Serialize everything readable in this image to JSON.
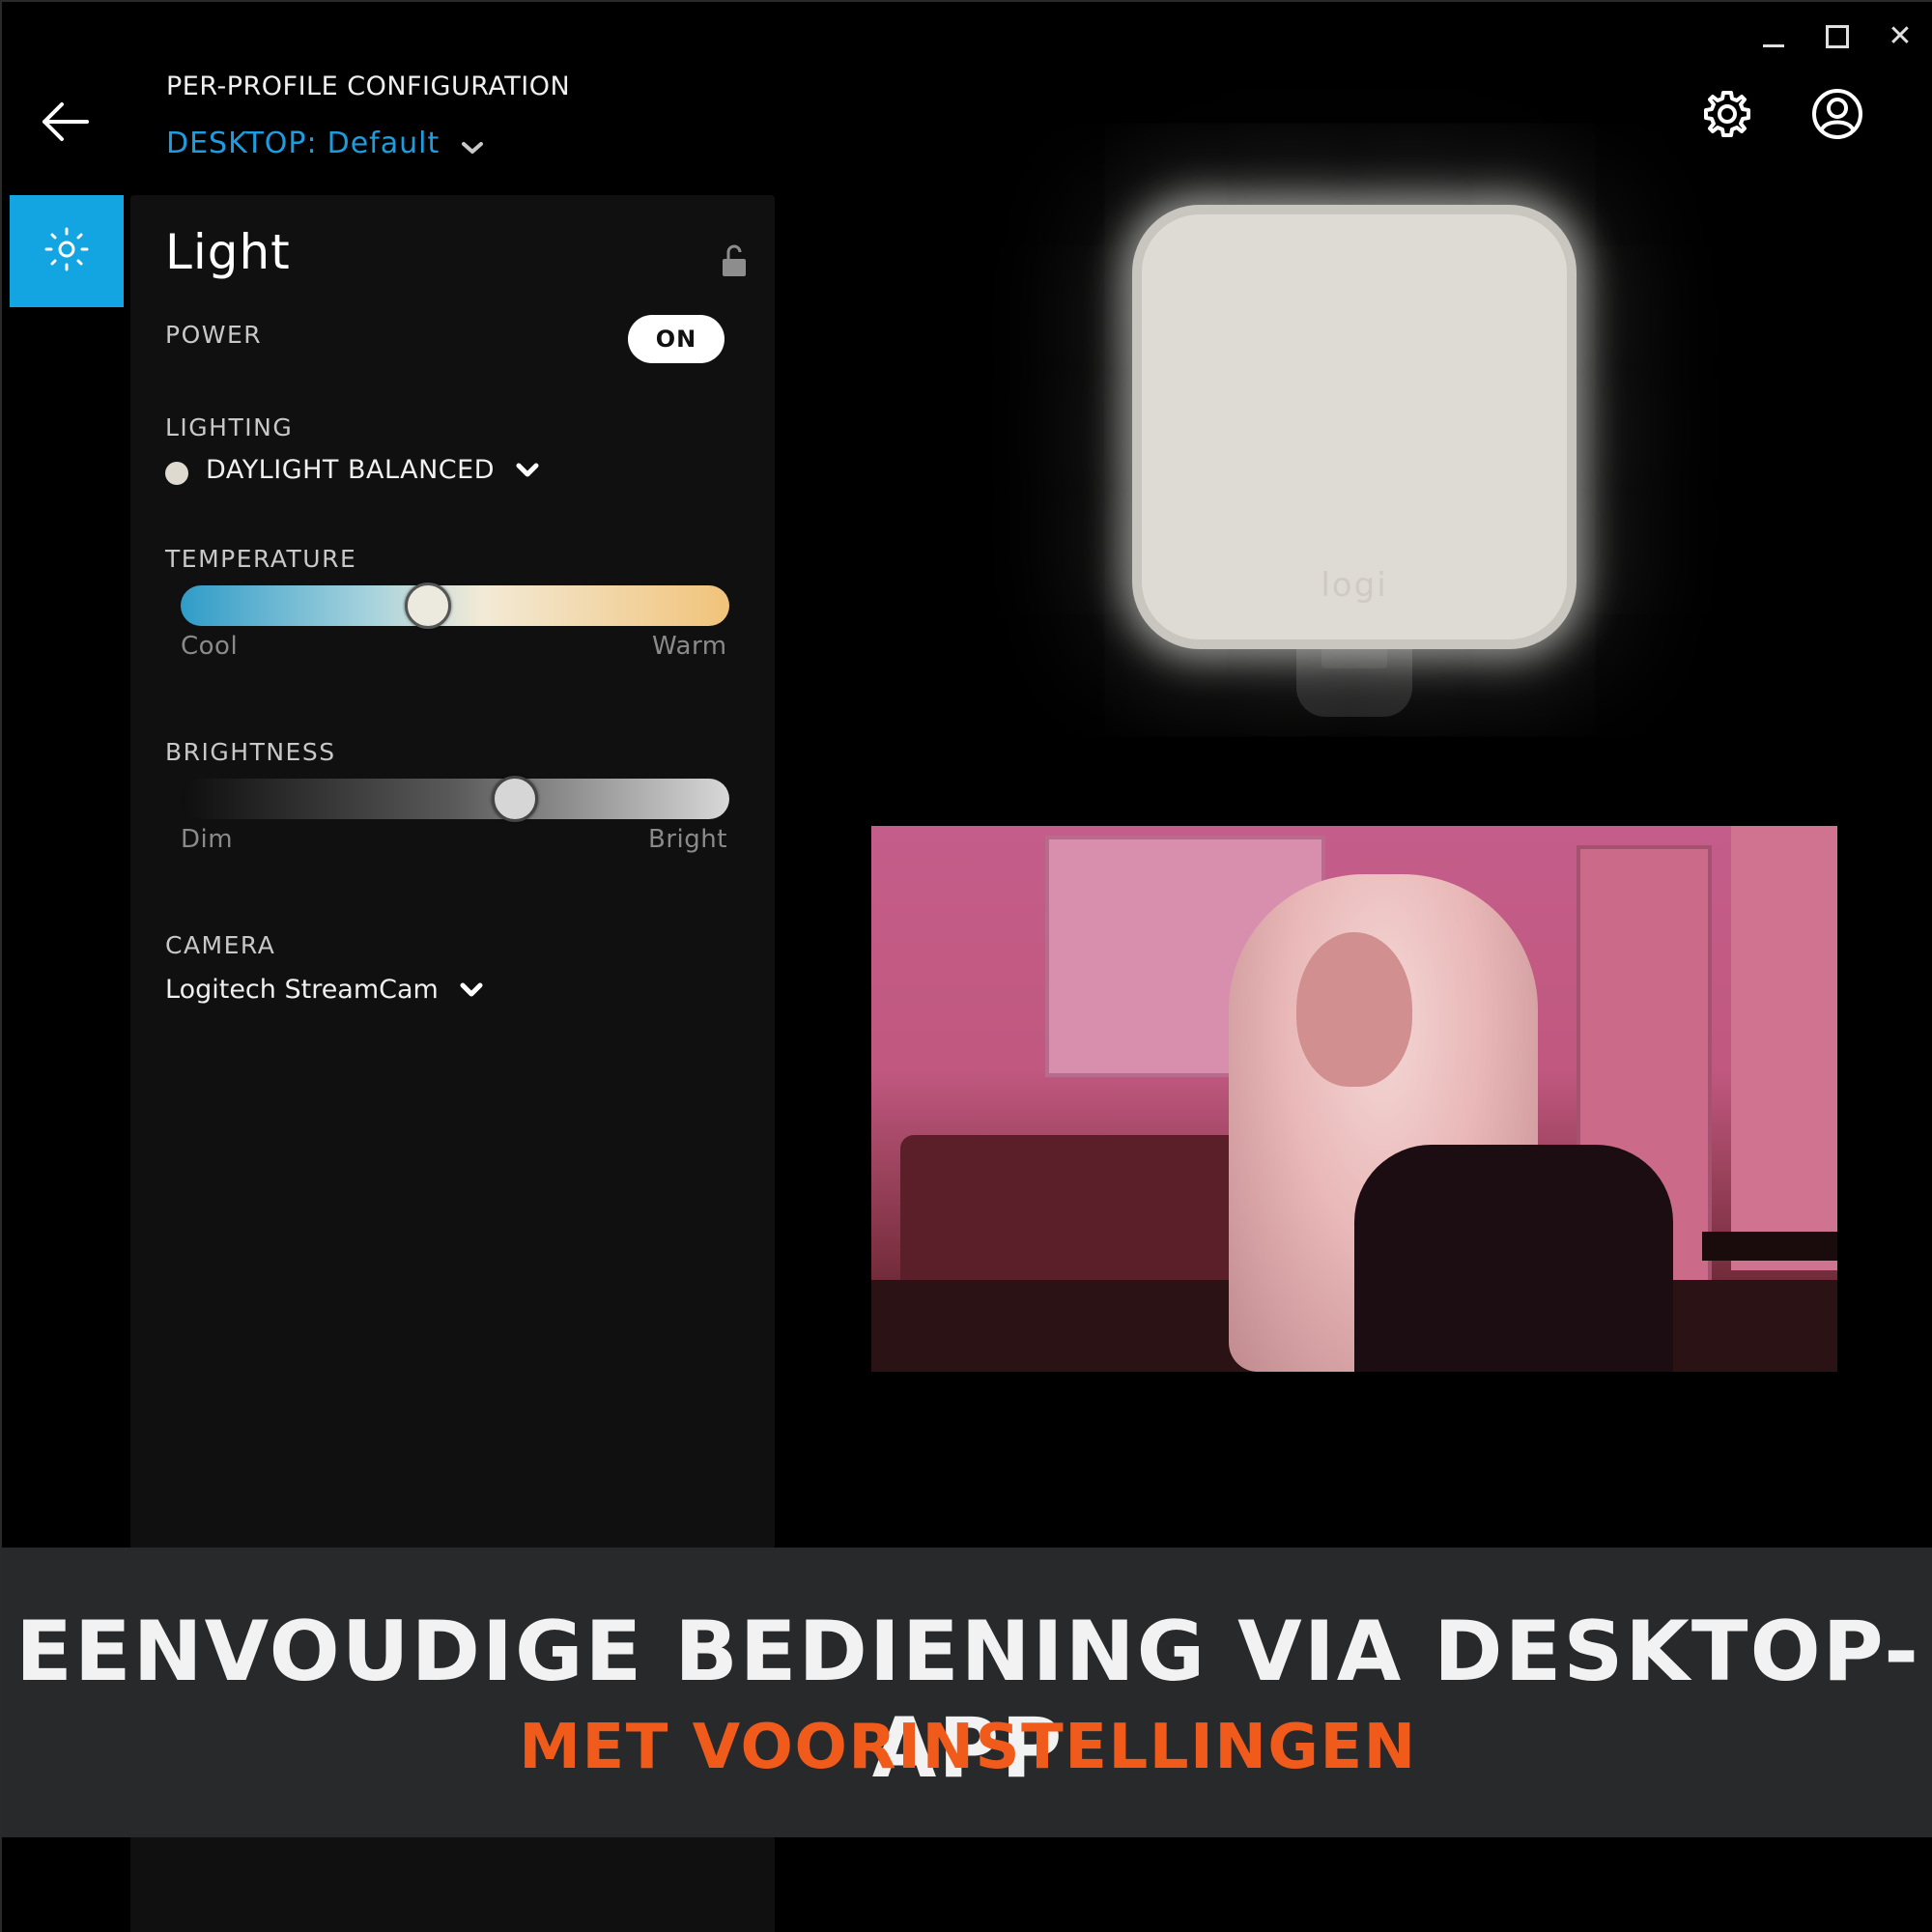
{
  "window": {
    "close_glyph": "✕"
  },
  "header": {
    "title": "PER-PROFILE CONFIGURATION",
    "profile_label": "DESKTOP:",
    "profile_value": "Default"
  },
  "panel": {
    "title": "Light",
    "power": {
      "label": "POWER",
      "state": "ON"
    },
    "lighting": {
      "label": "LIGHTING",
      "value": "DAYLIGHT BALANCED"
    },
    "temperature": {
      "label": "TEMPERATURE",
      "min_label": "Cool",
      "max_label": "Warm",
      "level": 0.45
    },
    "brightness": {
      "label": "BRIGHTNESS",
      "min_label": "Dim",
      "max_label": "Bright",
      "level": 0.61
    },
    "camera": {
      "label": "CAMERA",
      "value": "Logitech StreamCam"
    }
  },
  "device": {
    "logo": "logi"
  },
  "banner": {
    "title": "EENVOUDIGE BEDIENING VIA DESKTOP-APP",
    "subtitle": "MET VOORINSTELLINGEN"
  },
  "colors": {
    "accent": "#13a4e2",
    "profile_text": "#1d9de0",
    "banner_subtitle": "#f05a1a",
    "banner_bg": "#27292b"
  },
  "icons": [
    "back-arrow-icon",
    "chevron-down-icon",
    "gear-icon",
    "account-icon",
    "light-icon",
    "lock-open-icon",
    "minimize-icon",
    "maximize-icon",
    "close-icon"
  ]
}
